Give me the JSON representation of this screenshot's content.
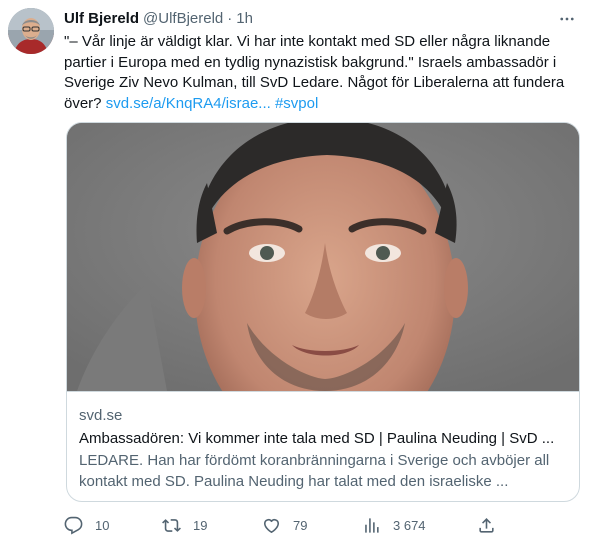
{
  "author": {
    "name": "Ulf Bjereld",
    "handle": "@UlfBjereld",
    "separator": "·",
    "time": "1h"
  },
  "tweet": {
    "text_main": "\"– Vår linje är väldigt klar. Vi har inte kontakt med SD eller några liknande partier i Europa med en tydlig nynazistisk bakgrund.\" Israels ambassadör i Sverige Ziv Nevo Kulman, till SvD Ledare. Något för Liberalerna att fundera över? ",
    "link": "svd.se/a/KnqRA4/israe...",
    "hashtag": "#svpol"
  },
  "card": {
    "domain": "svd.se",
    "title": "Ambassadören: Vi kommer inte tala med SD | Paulina Neuding | SvD ...",
    "description": "LEDARE. Han har fördömt koranbränningarna i Sverige och avböjer all kontakt med SD. Paulina Neuding har talat med den israeliske ..."
  },
  "actions": {
    "replies": "10",
    "retweets": "19",
    "likes": "79",
    "views": "3 674"
  },
  "icons": {
    "more": "more-dots-icon",
    "reply": "reply-icon",
    "retweet": "retweet-icon",
    "like": "heart-icon",
    "views": "views-bar-chart-icon",
    "share": "share-icon"
  },
  "colors": {
    "text": "#0f1419",
    "secondary": "#536471",
    "link": "#1d9bf0",
    "border": "#cfd9de"
  }
}
